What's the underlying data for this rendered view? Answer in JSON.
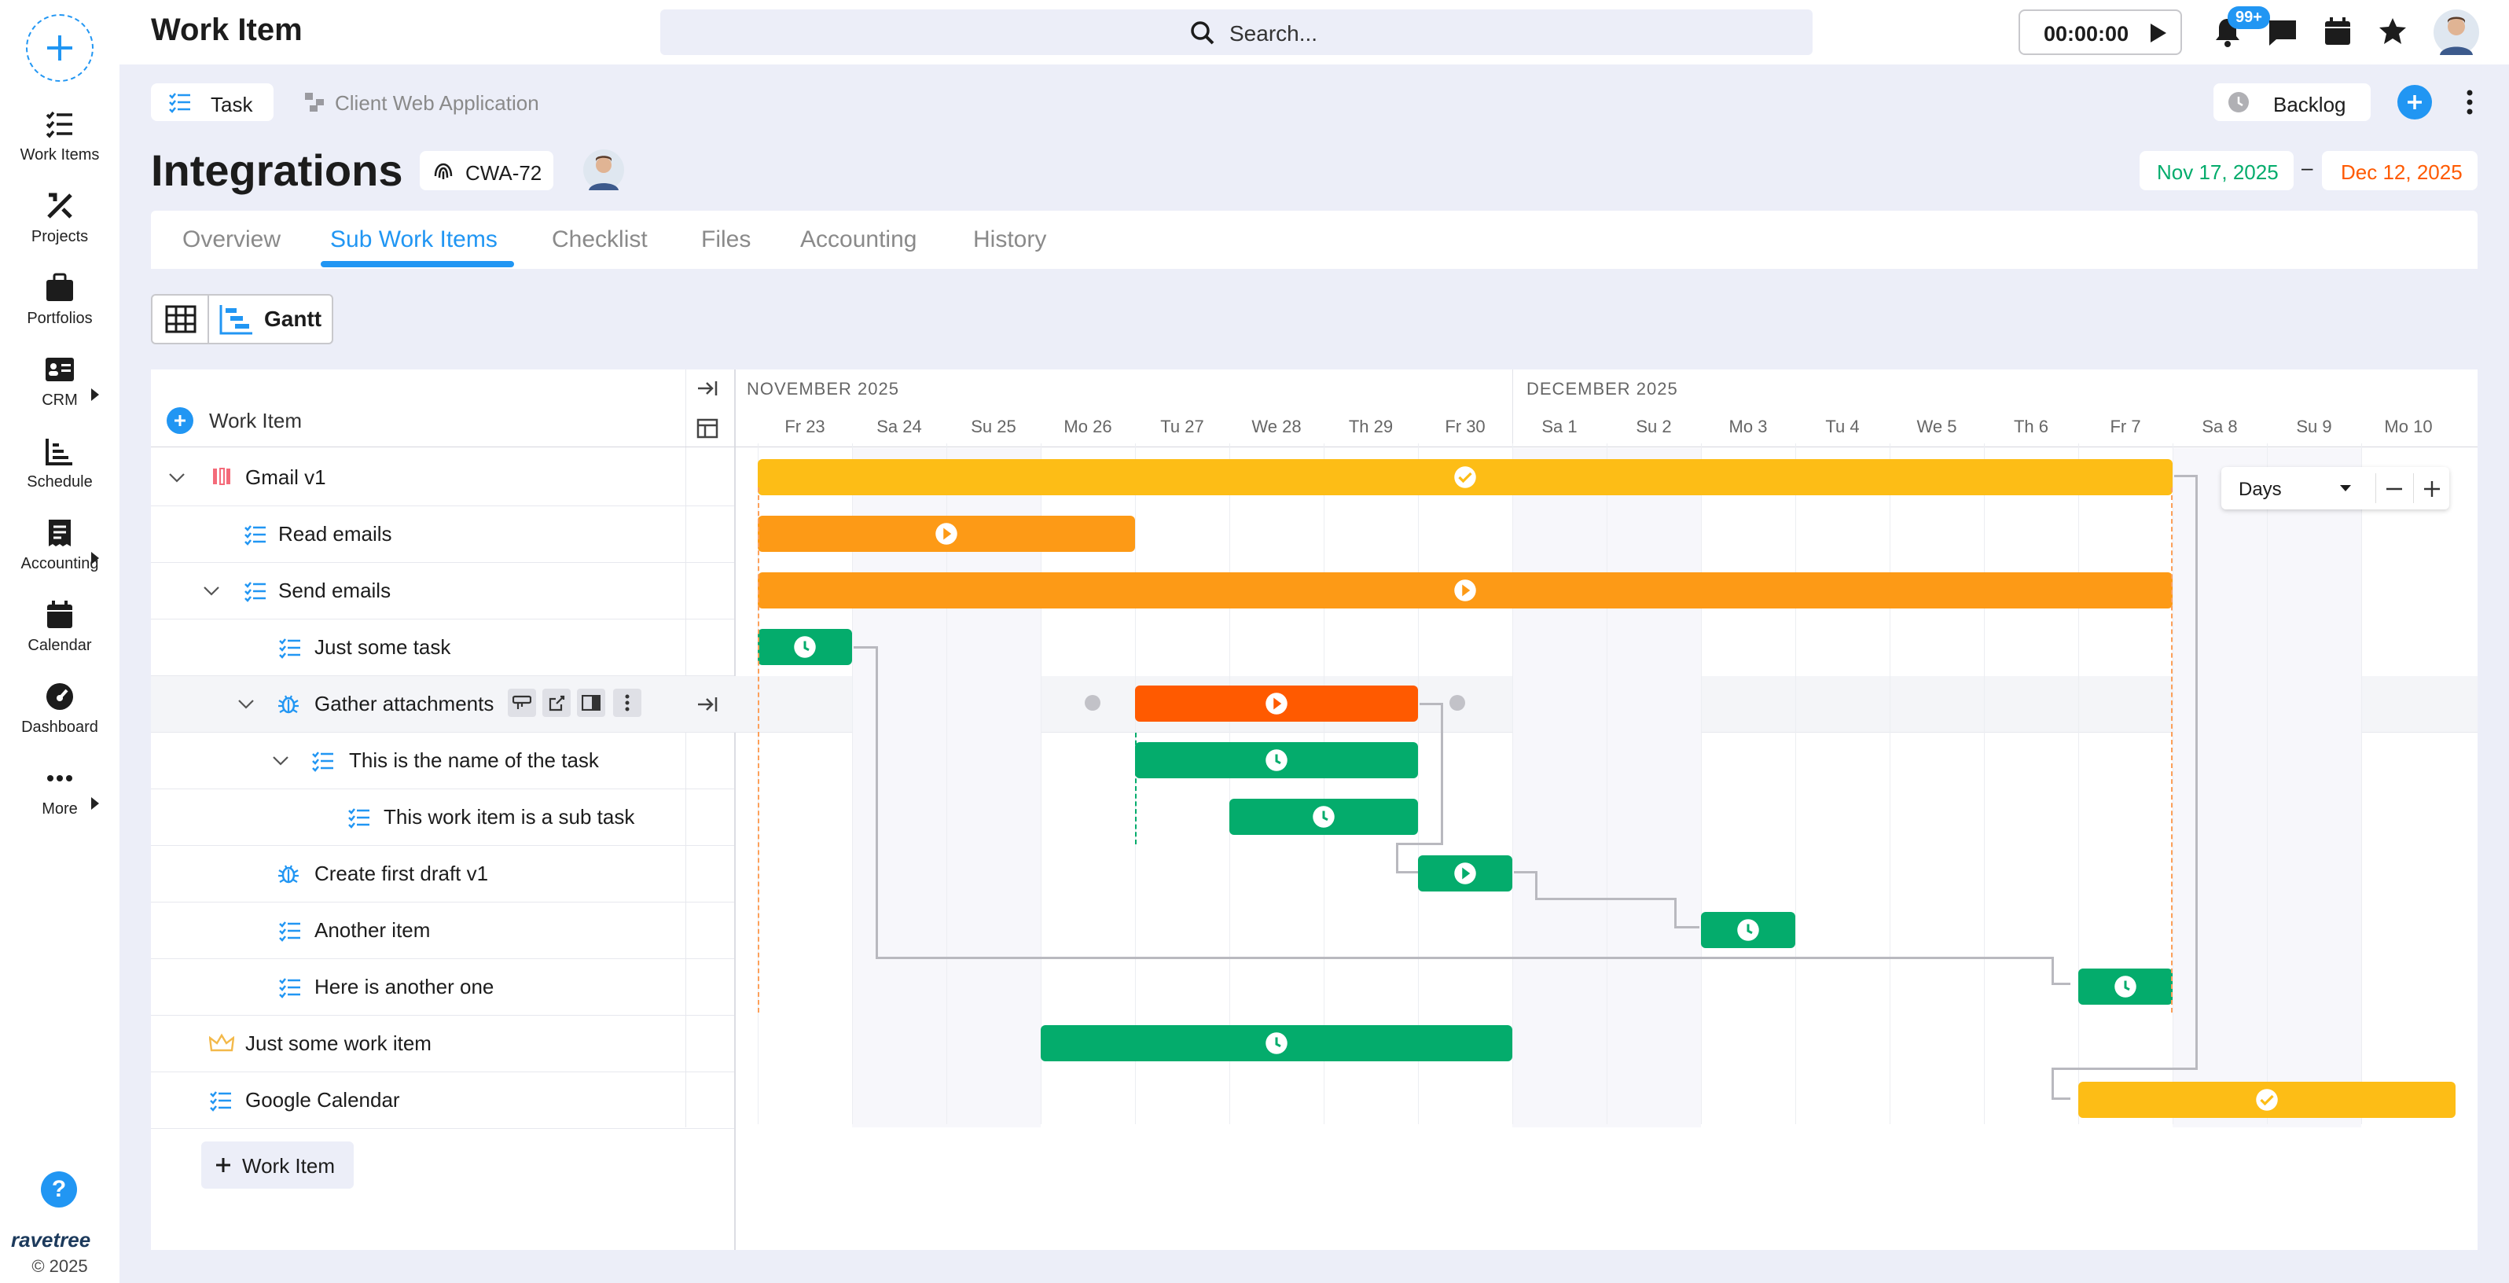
{
  "app": {
    "title": "Work Item",
    "timer": "00:00:00",
    "notif_badge": "99+",
    "search_placeholder": "Search...",
    "brand": "ravetree",
    "copyright": "© 2025"
  },
  "sidebar": {
    "items": [
      {
        "label": "Work Items"
      },
      {
        "label": "Projects"
      },
      {
        "label": "Portfolios"
      },
      {
        "label": "CRM"
      },
      {
        "label": "Schedule"
      },
      {
        "label": "Accounting"
      },
      {
        "label": "Calendar"
      },
      {
        "label": "Dashboard"
      },
      {
        "label": "More"
      }
    ]
  },
  "crumb": {
    "type": "Task",
    "project": "Client Web Application",
    "status": "Backlog"
  },
  "item": {
    "title": "Integrations",
    "code": "CWA-72",
    "start_date": "Nov 17, 2025",
    "end_date": "Dec 12, 2025",
    "date_sep": "–"
  },
  "tabs": [
    "Overview",
    "Sub Work Items",
    "Checklist",
    "Files",
    "Accounting",
    "History"
  ],
  "view": {
    "gantt_label": "Gantt",
    "column_header": "Work Item",
    "add_label": "Work Item",
    "scale": "Days"
  },
  "gantt": {
    "months": [
      "NOVEMBER 2025",
      "DECEMBER 2025"
    ],
    "days": [
      "Fr 23",
      "Sa 24",
      "Su 25",
      "Mo 26",
      "Tu 27",
      "We 28",
      "Th 29",
      "Fr 30",
      "Sa 1",
      "Su 2",
      "Mo 3",
      "Tu 4",
      "We 5",
      "Th 6",
      "Fr 7",
      "Sa 8",
      "Su 9",
      "Mo 10"
    ]
  },
  "rows": [
    {
      "label": "Gmail v1",
      "icon": "milestone-icon"
    },
    {
      "label": "Read emails",
      "icon": "task-icon"
    },
    {
      "label": "Send emails",
      "icon": "task-icon"
    },
    {
      "label": "Just some task",
      "icon": "task-icon"
    },
    {
      "label": "Gather attachments",
      "icon": "bug-icon"
    },
    {
      "label": "This is the name of the task",
      "icon": "task-icon"
    },
    {
      "label": "This work item is a sub task",
      "icon": "task-icon"
    },
    {
      "label": "Create first draft v1",
      "icon": "bug-icon"
    },
    {
      "label": "Another item",
      "icon": "task-icon"
    },
    {
      "label": "Here is another one",
      "icon": "task-icon"
    },
    {
      "label": "Just some work item",
      "icon": "crown-icon"
    },
    {
      "label": "Google Calendar",
      "icon": "task-icon"
    }
  ],
  "bars": [
    {
      "row": "Gmail v1",
      "start": "Fr 23",
      "end": "Fr 7",
      "status": "done",
      "color": "#fdbd16"
    },
    {
      "row": "Read emails",
      "start": "Fr 23",
      "end": "Mo 26",
      "status": "in-progress",
      "color": "#fd9a16"
    },
    {
      "row": "Send emails",
      "start": "Fr 23",
      "end": "Fr 7",
      "status": "in-progress",
      "color": "#fd9a16"
    },
    {
      "row": "Just some task",
      "start": "Fr 23",
      "end": "Fr 23",
      "status": "scheduled",
      "color": "#04ac6c"
    },
    {
      "row": "Gather attachments",
      "start": "Tu 27",
      "end": "Th 29",
      "status": "in-progress",
      "color": "#ff5a00"
    },
    {
      "row": "This is the name of the task",
      "start": "Tu 27",
      "end": "Th 29",
      "status": "scheduled",
      "color": "#04ac6c"
    },
    {
      "row": "This work item is a sub task",
      "start": "We 28",
      "end": "Th 29",
      "status": "scheduled",
      "color": "#04ac6c"
    },
    {
      "row": "Create first draft v1",
      "start": "Fr 30",
      "end": "Fr 30",
      "status": "in-progress",
      "color": "#04ac6c"
    },
    {
      "row": "Another item",
      "start": "Mo 3",
      "end": "Mo 3",
      "status": "scheduled",
      "color": "#04ac6c"
    },
    {
      "row": "Here is another one",
      "start": "Fr 7",
      "end": "Fr 7",
      "status": "scheduled",
      "color": "#04ac6c"
    },
    {
      "row": "Just some work item",
      "start": "Mo 26",
      "end": "Fr 30",
      "status": "scheduled",
      "color": "#04ac6c"
    },
    {
      "row": "Google Calendar",
      "start": "Fr 7",
      "end": "Mo 10",
      "status": "done",
      "color": "#fdbd16"
    }
  ]
}
